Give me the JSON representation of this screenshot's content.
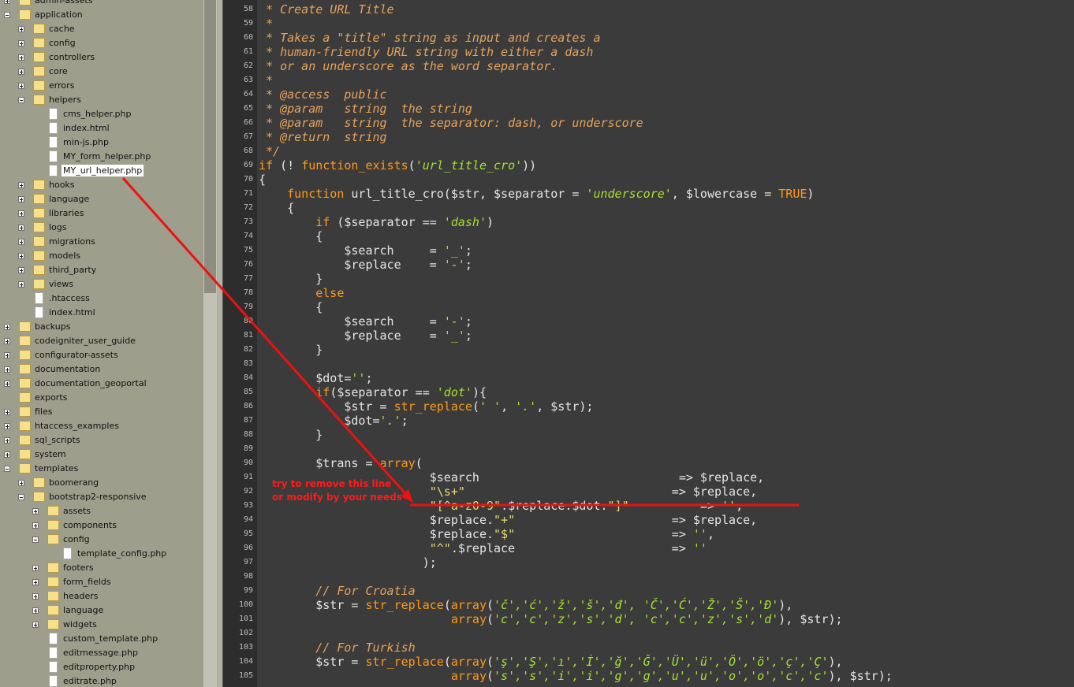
{
  "tree": [
    {
      "depth": 0,
      "type": "folder",
      "exp": "plus",
      "name": "admin-assets"
    },
    {
      "depth": 0,
      "type": "folder",
      "exp": "minus",
      "name": "application"
    },
    {
      "depth": 1,
      "type": "folder",
      "exp": "plus",
      "name": "cache"
    },
    {
      "depth": 1,
      "type": "folder",
      "exp": "plus",
      "name": "config"
    },
    {
      "depth": 1,
      "type": "folder",
      "exp": "plus",
      "name": "controllers"
    },
    {
      "depth": 1,
      "type": "folder",
      "exp": "plus",
      "name": "core"
    },
    {
      "depth": 1,
      "type": "folder",
      "exp": "plus",
      "name": "errors"
    },
    {
      "depth": 1,
      "type": "folder",
      "exp": "minus",
      "name": "helpers"
    },
    {
      "depth": 2,
      "type": "file",
      "name": "cms_helper.php"
    },
    {
      "depth": 2,
      "type": "file",
      "name": "index.html"
    },
    {
      "depth": 2,
      "type": "file",
      "name": "min-js.php"
    },
    {
      "depth": 2,
      "type": "file",
      "name": "MY_form_helper.php"
    },
    {
      "depth": 2,
      "type": "file",
      "name": "MY_url_helper.php",
      "selected": true
    },
    {
      "depth": 1,
      "type": "folder",
      "exp": "plus",
      "name": "hooks"
    },
    {
      "depth": 1,
      "type": "folder",
      "exp": "plus",
      "name": "language"
    },
    {
      "depth": 1,
      "type": "folder",
      "exp": "plus",
      "name": "libraries"
    },
    {
      "depth": 1,
      "type": "folder",
      "exp": "plus",
      "name": "logs"
    },
    {
      "depth": 1,
      "type": "folder",
      "exp": "plus",
      "name": "migrations"
    },
    {
      "depth": 1,
      "type": "folder",
      "exp": "plus",
      "name": "models"
    },
    {
      "depth": 1,
      "type": "folder",
      "exp": "plus",
      "name": "third_party"
    },
    {
      "depth": 1,
      "type": "folder",
      "exp": "plus",
      "name": "views"
    },
    {
      "depth": 1,
      "type": "file",
      "name": ".htaccess"
    },
    {
      "depth": 1,
      "type": "file",
      "name": "index.html"
    },
    {
      "depth": 0,
      "type": "folder",
      "exp": "plus",
      "name": "backups"
    },
    {
      "depth": 0,
      "type": "folder",
      "exp": "plus",
      "name": "codeigniter_user_guide"
    },
    {
      "depth": 0,
      "type": "folder",
      "exp": "plus",
      "name": "configurator-assets"
    },
    {
      "depth": 0,
      "type": "folder",
      "exp": "plus",
      "name": "documentation"
    },
    {
      "depth": 0,
      "type": "folder",
      "exp": "plus",
      "name": "documentation_geoportal"
    },
    {
      "depth": 0,
      "type": "folder",
      "exp": "none",
      "name": "exports"
    },
    {
      "depth": 0,
      "type": "folder",
      "exp": "plus",
      "name": "files"
    },
    {
      "depth": 0,
      "type": "folder",
      "exp": "plus",
      "name": "htaccess_examples"
    },
    {
      "depth": 0,
      "type": "folder",
      "exp": "plus",
      "name": "sql_scripts"
    },
    {
      "depth": 0,
      "type": "folder",
      "exp": "plus",
      "name": "system"
    },
    {
      "depth": 0,
      "type": "folder",
      "exp": "minus",
      "name": "templates"
    },
    {
      "depth": 1,
      "type": "folder",
      "exp": "plus",
      "name": "boomerang"
    },
    {
      "depth": 1,
      "type": "folder",
      "exp": "minus",
      "name": "bootstrap2-responsive"
    },
    {
      "depth": 2,
      "type": "folder",
      "exp": "plus",
      "name": "assets"
    },
    {
      "depth": 2,
      "type": "folder",
      "exp": "plus",
      "name": "components"
    },
    {
      "depth": 2,
      "type": "folder",
      "exp": "minus",
      "name": "config"
    },
    {
      "depth": 3,
      "type": "file",
      "name": "template_config.php"
    },
    {
      "depth": 2,
      "type": "folder",
      "exp": "plus",
      "name": "footers"
    },
    {
      "depth": 2,
      "type": "folder",
      "exp": "plus",
      "name": "form_fields"
    },
    {
      "depth": 2,
      "type": "folder",
      "exp": "plus",
      "name": "headers"
    },
    {
      "depth": 2,
      "type": "folder",
      "exp": "plus",
      "name": "language"
    },
    {
      "depth": 2,
      "type": "folder",
      "exp": "plus",
      "name": "widgets"
    },
    {
      "depth": 2,
      "type": "file",
      "name": "custom_template.php"
    },
    {
      "depth": 2,
      "type": "file",
      "name": "editmessage.php"
    },
    {
      "depth": 2,
      "type": "file",
      "name": "editproperty.php"
    },
    {
      "depth": 2,
      "type": "file",
      "name": "editrate.php"
    }
  ],
  "code": [
    {
      "n": "58",
      "seg": [
        [
          " * Create URL Title",
          "cm"
        ]
      ]
    },
    {
      "n": "59",
      "seg": [
        [
          " *",
          "cm"
        ]
      ]
    },
    {
      "n": "60",
      "seg": [
        [
          " * Takes a \"title\" string as input and creates a",
          "cm"
        ]
      ]
    },
    {
      "n": "61",
      "seg": [
        [
          " * human-friendly URL string with either a dash",
          "cm"
        ]
      ]
    },
    {
      "n": "62",
      "seg": [
        [
          " * or an underscore as the word separator.",
          "cm"
        ]
      ]
    },
    {
      "n": "63",
      "seg": [
        [
          " *",
          "cm"
        ]
      ]
    },
    {
      "n": "64",
      "seg": [
        [
          " * @access  public",
          "cm"
        ]
      ]
    },
    {
      "n": "65",
      "seg": [
        [
          " * @param   string  the string",
          "cm"
        ]
      ]
    },
    {
      "n": "66",
      "seg": [
        [
          " * @param   string  the separator: dash, or underscore",
          "cm"
        ]
      ]
    },
    {
      "n": "67",
      "seg": [
        [
          " * @return  string",
          "cm"
        ]
      ]
    },
    {
      "n": "68",
      "seg": [
        [
          " */",
          "cm"
        ]
      ]
    },
    {
      "n": "69",
      "seg": [
        [
          "if",
          "kw"
        ],
        [
          " (! ",
          "tx"
        ],
        [
          "function_exists",
          "kw"
        ],
        [
          "(",
          "tx"
        ],
        [
          "'url_title_cro'",
          "st"
        ],
        [
          "))",
          "tx"
        ]
      ]
    },
    {
      "n": "70",
      "seg": [
        [
          "{",
          "tx"
        ]
      ]
    },
    {
      "n": "71",
      "seg": [
        [
          "    ",
          "tx"
        ],
        [
          "function",
          "kw"
        ],
        [
          " url_title_cro($str, $separator = ",
          "tx"
        ],
        [
          "'underscore'",
          "st"
        ],
        [
          ", $lowercase = ",
          "tx"
        ],
        [
          "TRUE",
          "kw"
        ],
        [
          ")",
          "tx"
        ]
      ]
    },
    {
      "n": "72",
      "seg": [
        [
          "    {",
          "tx"
        ]
      ]
    },
    {
      "n": "73",
      "seg": [
        [
          "        ",
          "tx"
        ],
        [
          "if",
          "kw"
        ],
        [
          " ($separator == ",
          "tx"
        ],
        [
          "'dash'",
          "st"
        ],
        [
          ")",
          "tx"
        ]
      ]
    },
    {
      "n": "74",
      "seg": [
        [
          "        {",
          "tx"
        ]
      ]
    },
    {
      "n": "75",
      "seg": [
        [
          "            $search     = ",
          "tx"
        ],
        [
          "'_'",
          "st"
        ],
        [
          ";",
          "tx"
        ]
      ]
    },
    {
      "n": "76",
      "seg": [
        [
          "            $replace    = ",
          "tx"
        ],
        [
          "'-'",
          "st"
        ],
        [
          ";",
          "tx"
        ]
      ]
    },
    {
      "n": "77",
      "seg": [
        [
          "        }",
          "tx"
        ]
      ]
    },
    {
      "n": "78",
      "seg": [
        [
          "        ",
          "tx"
        ],
        [
          "else",
          "kw"
        ]
      ]
    },
    {
      "n": "79",
      "seg": [
        [
          "        {",
          "tx"
        ]
      ]
    },
    {
      "n": "80",
      "seg": [
        [
          "            $search     = ",
          "tx"
        ],
        [
          "'-'",
          "st"
        ],
        [
          ";",
          "tx"
        ]
      ]
    },
    {
      "n": "81",
      "seg": [
        [
          "            $replace    = ",
          "tx"
        ],
        [
          "'_'",
          "st"
        ],
        [
          ";",
          "tx"
        ]
      ]
    },
    {
      "n": "82",
      "seg": [
        [
          "        }",
          "tx"
        ]
      ]
    },
    {
      "n": "83",
      "seg": [
        [
          "",
          "tx"
        ]
      ]
    },
    {
      "n": "84",
      "seg": [
        [
          "        $dot=",
          "tx"
        ],
        [
          "''",
          "st"
        ],
        [
          ";",
          "tx"
        ]
      ]
    },
    {
      "n": "85",
      "seg": [
        [
          "        ",
          "tx"
        ],
        [
          "if",
          "kw"
        ],
        [
          "($separator == ",
          "tx"
        ],
        [
          "'dot'",
          "st"
        ],
        [
          "){",
          "tx"
        ]
      ]
    },
    {
      "n": "86",
      "seg": [
        [
          "            $str = ",
          "tx"
        ],
        [
          "str_replace",
          "kw"
        ],
        [
          "(",
          "tx"
        ],
        [
          "' '",
          "st"
        ],
        [
          ", ",
          "tx"
        ],
        [
          "'.'",
          "st"
        ],
        [
          ", $str);",
          "tx"
        ]
      ]
    },
    {
      "n": "87",
      "seg": [
        [
          "            $dot=",
          "tx"
        ],
        [
          "'.'",
          "st"
        ],
        [
          ";",
          "tx"
        ]
      ]
    },
    {
      "n": "88",
      "seg": [
        [
          "        }",
          "tx"
        ]
      ]
    },
    {
      "n": "89",
      "seg": [
        [
          "",
          "tx"
        ]
      ]
    },
    {
      "n": "90",
      "seg": [
        [
          "        $trans = ",
          "tx"
        ],
        [
          "array",
          "kw"
        ],
        [
          "(",
          "tx"
        ]
      ]
    },
    {
      "n": "91",
      "seg": [
        [
          "                        $search                            => $replace,",
          "tx"
        ]
      ]
    },
    {
      "n": "92",
      "seg": [
        [
          "                        ",
          "tx"
        ],
        [
          "\"\\s+\"",
          "sp"
        ],
        [
          "                             => $replace,",
          "tx"
        ]
      ]
    },
    {
      "n": "93",
      "seg": [
        [
          "                        ",
          "tx"
        ],
        [
          "\"[^a-z0-9\"",
          "sp"
        ],
        [
          ".$replace.$dot.",
          "tx"
        ],
        [
          "\"]\"",
          "sp"
        ],
        [
          "          => ",
          "tx"
        ],
        [
          "''",
          "st"
        ],
        [
          ",",
          "tx"
        ]
      ]
    },
    {
      "n": "94",
      "seg": [
        [
          "                        $replace.",
          "tx"
        ],
        [
          "\"+\"",
          "sp"
        ],
        [
          "                      => $replace,",
          "tx"
        ]
      ]
    },
    {
      "n": "95",
      "seg": [
        [
          "                        $replace.",
          "tx"
        ],
        [
          "\"$\"",
          "sp"
        ],
        [
          "                      => ",
          "tx"
        ],
        [
          "''",
          "st"
        ],
        [
          ",",
          "tx"
        ]
      ]
    },
    {
      "n": "96",
      "seg": [
        [
          "                        ",
          "tx"
        ],
        [
          "\"^\"",
          "sp"
        ],
        [
          ".$replace                      => ",
          "tx"
        ],
        [
          "''",
          "st"
        ]
      ]
    },
    {
      "n": "97",
      "seg": [
        [
          "                       );",
          "tx"
        ]
      ]
    },
    {
      "n": "98",
      "seg": [
        [
          "",
          "tx"
        ]
      ]
    },
    {
      "n": "99",
      "seg": [
        [
          "        ",
          "tx"
        ],
        [
          "// For Croatia",
          "cm"
        ]
      ]
    },
    {
      "n": "100",
      "seg": [
        [
          "        $str = ",
          "tx"
        ],
        [
          "str_replace",
          "kw"
        ],
        [
          "(",
          "tx"
        ],
        [
          "array",
          "kw"
        ],
        [
          "(",
          "tx"
        ],
        [
          "'č','ć','ž','š','đ', 'Č','Ć','Ž','Š','Đ'",
          "st"
        ],
        [
          "),",
          "tx"
        ]
      ]
    },
    {
      "n": "101",
      "seg": [
        [
          "                           ",
          "tx"
        ],
        [
          "array",
          "kw"
        ],
        [
          "(",
          "tx"
        ],
        [
          "'c','c','z','s','d', 'c','c','z','s','d'",
          "st"
        ],
        [
          "), $str);",
          "tx"
        ]
      ]
    },
    {
      "n": "102",
      "seg": [
        [
          "",
          "tx"
        ]
      ]
    },
    {
      "n": "103",
      "seg": [
        [
          "        ",
          "tx"
        ],
        [
          "// For Turkish",
          "cm"
        ]
      ]
    },
    {
      "n": "104",
      "seg": [
        [
          "        $str = ",
          "tx"
        ],
        [
          "str_replace",
          "kw"
        ],
        [
          "(",
          "tx"
        ],
        [
          "array",
          "kw"
        ],
        [
          "(",
          "tx"
        ],
        [
          "'ş','Ş','ı','İ','ğ','Ğ','Ü','ü','Ö','ö','ç','Ç'",
          "st"
        ],
        [
          "),",
          "tx"
        ]
      ]
    },
    {
      "n": "105",
      "seg": [
        [
          "                           ",
          "tx"
        ],
        [
          "array",
          "kw"
        ],
        [
          "(",
          "tx"
        ],
        [
          "'s','s','i','i','g','g','u','u','o','o','c','c'",
          "st"
        ],
        [
          "), $str);",
          "tx"
        ]
      ]
    }
  ],
  "annotation": {
    "line1": "try to remove this line",
    "line2": "or modify by your needs",
    "color": "#ff1a1a"
  },
  "icons": {
    "folder": "folder-icon",
    "file": "file-icon",
    "expander": "tree-expander-icon"
  }
}
